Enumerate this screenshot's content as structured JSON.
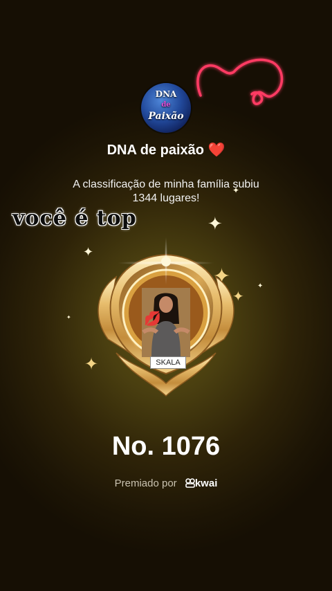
{
  "logo": {
    "line1": "DNA",
    "line2": "de",
    "line3": "Paixão"
  },
  "title": "DNA de paixão",
  "title_emoji": "❤️",
  "message_line1": "A classificação de minha família subiu",
  "message_line2": "1344 lugares!",
  "overlay_text": "você  é top",
  "badge_label": "SKALA",
  "rank": "No. 1076",
  "footer": {
    "prefix": "Premiado por",
    "brand": "kwai"
  },
  "colors": {
    "accent_gold": "#e0b45a",
    "neon_pink": "#ff3a64",
    "background_dark": "#1d1505"
  }
}
